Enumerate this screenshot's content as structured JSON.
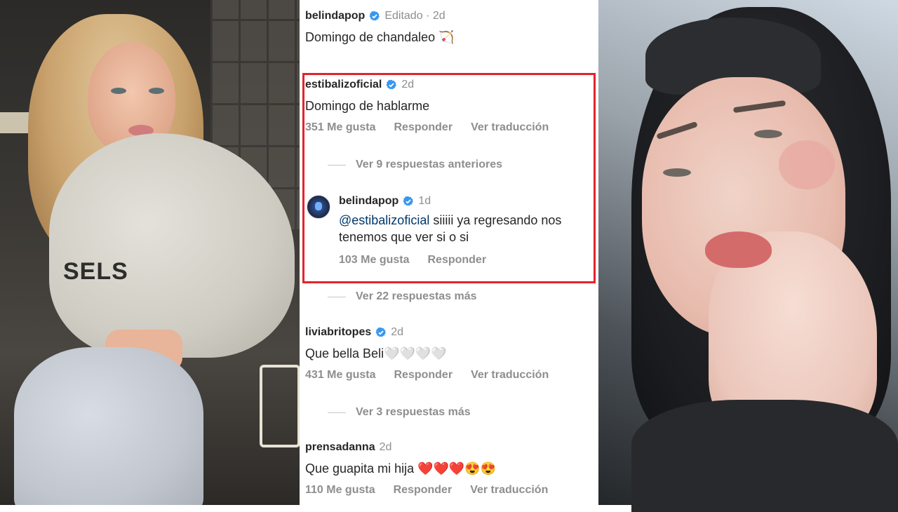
{
  "post": {
    "author": "belindapop",
    "meta": "Editado · 2d",
    "caption": "Domingo de chandaleo 🏹"
  },
  "comments": [
    {
      "user": "estibalizoficial",
      "time": "2d",
      "text": "Domingo de hablarme",
      "likes": "351 Me gusta",
      "reply": "Responder",
      "translate": "Ver traducción",
      "replies_toggle": "Ver 9 respuestas anteriores"
    },
    {
      "user": "belindapop",
      "time": "1d",
      "mention": "@estibalizoficial",
      "text": " siiiii ya regresando nos tenemos que ver si o si",
      "likes": "103 Me gusta",
      "reply": "Responder",
      "replies_toggle": "Ver 22 respuestas más"
    },
    {
      "user": "liviabritopes",
      "time": "2d",
      "text": "Que bella Beli",
      "emoji": "🤍🤍🤍🤍",
      "likes": "431 Me gusta",
      "reply": "Responder",
      "translate": "Ver traducción",
      "replies_toggle": "Ver 3 respuestas más"
    },
    {
      "user": "prensadanna",
      "time": "2d",
      "text": "Que guapita mi hija",
      "emoji": "❤️❤️❤️😍😍",
      "likes": "110 Me gusta",
      "reply": "Responder",
      "translate": "Ver traducción"
    }
  ],
  "sweatshirt_print": "SELS",
  "colors": {
    "highlight": "#e3242b",
    "verified": "#3897f0",
    "muted": "#8e8e8e",
    "text": "#262626"
  }
}
